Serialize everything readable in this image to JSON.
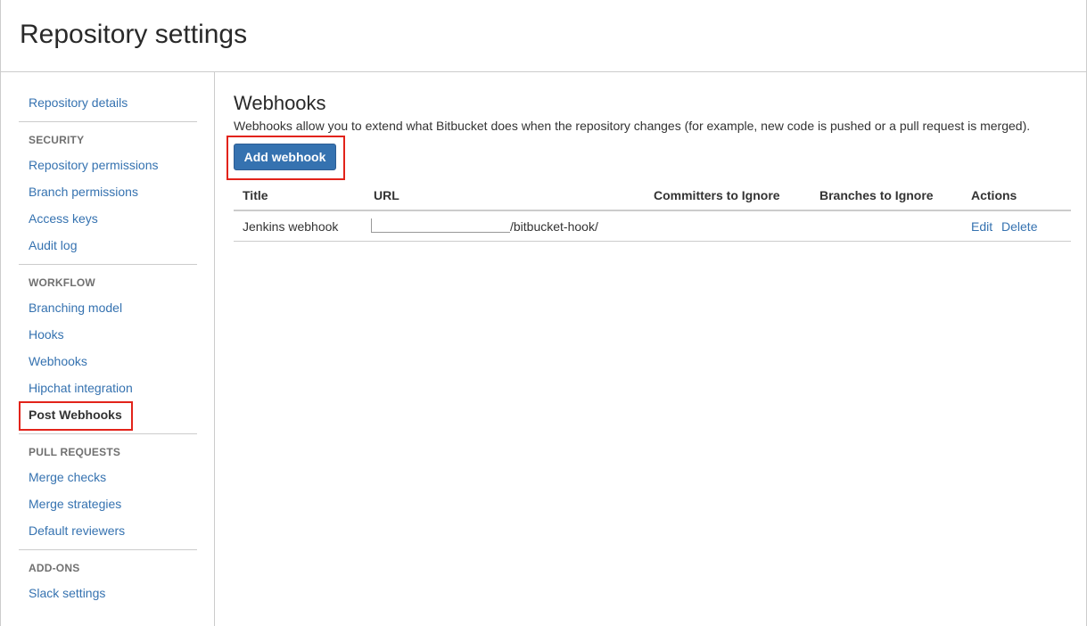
{
  "header": {
    "title": "Repository settings"
  },
  "sidebar": {
    "top_item": "Repository details",
    "sections": [
      {
        "heading": "SECURITY",
        "items": [
          "Repository permissions",
          "Branch permissions",
          "Access keys",
          "Audit log"
        ]
      },
      {
        "heading": "WORKFLOW",
        "items": [
          "Branching model",
          "Hooks",
          "Webhooks",
          "Hipchat integration",
          "Post Webhooks"
        ]
      },
      {
        "heading": "PULL REQUESTS",
        "items": [
          "Merge checks",
          "Merge strategies",
          "Default reviewers"
        ]
      },
      {
        "heading": "ADD-ONS",
        "items": [
          "Slack settings"
        ]
      }
    ],
    "active_item": "Post Webhooks"
  },
  "main": {
    "title": "Webhooks",
    "description": "Webhooks allow you to extend what Bitbucket does when the repository changes (for example, new code is pushed or a pull request is merged).",
    "add_button": "Add webhook",
    "table": {
      "columns": [
        "Title",
        "URL",
        "Committers to Ignore",
        "Branches to Ignore",
        "Actions"
      ],
      "rows": [
        {
          "title": "Jenkins webhook",
          "url_suffix": "/bitbucket-hook/",
          "committers": "",
          "branches": "",
          "edit": "Edit",
          "delete": "Delete"
        }
      ]
    }
  },
  "colors": {
    "link": "#3572b0",
    "button": "#3572b0",
    "highlight": "#e2231a",
    "border": "#cccccc"
  }
}
